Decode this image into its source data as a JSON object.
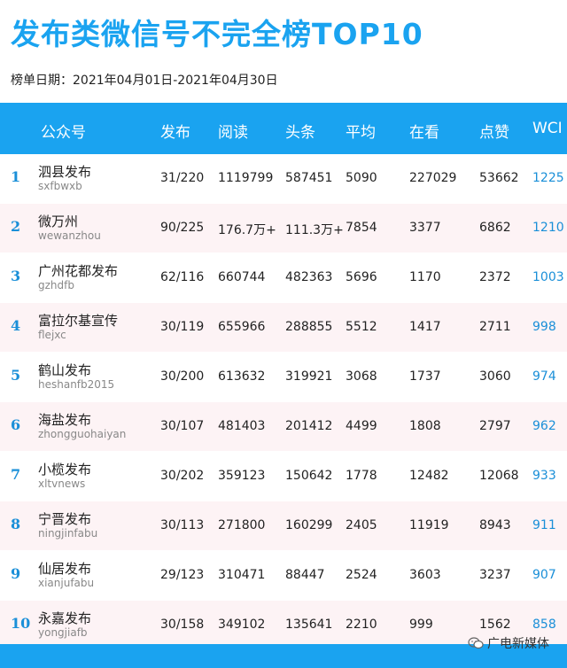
{
  "title": "发布类微信号不完全榜TOP10",
  "date_line": "榜单日期：2021年04月01日-2021年04月30日",
  "headers": {
    "account": "公众号",
    "fabu": "发布",
    "yuedu": "阅读",
    "toutiao": "头条",
    "pingjun": "平均",
    "zaikan": "在看",
    "dianzan": "点赞",
    "wci": "WCI"
  },
  "rows": [
    {
      "rank": "1",
      "name": "泗县发布",
      "account": "sxfbwxb",
      "fabu": "31/220",
      "yuedu": "1119799",
      "toutiao": "587451",
      "pingjun": "5090",
      "zaikan": "227029",
      "dianzan": "53662",
      "wci": "1225"
    },
    {
      "rank": "2",
      "name": "微万州",
      "account": "wewanzhou",
      "fabu": "90/225",
      "yuedu": "176.7万+",
      "toutiao": "111.3万+",
      "pingjun": "7854",
      "zaikan": "3377",
      "dianzan": "6862",
      "wci": "1210"
    },
    {
      "rank": "3",
      "name": "广州花都发布",
      "account": "gzhdfb",
      "fabu": "62/116",
      "yuedu": "660744",
      "toutiao": "482363",
      "pingjun": "5696",
      "zaikan": "1170",
      "dianzan": "2372",
      "wci": "1003"
    },
    {
      "rank": "4",
      "name": "富拉尔基宣传",
      "account": "flejxc",
      "fabu": "30/119",
      "yuedu": "655966",
      "toutiao": "288855",
      "pingjun": "5512",
      "zaikan": "1417",
      "dianzan": "2711",
      "wci": "998"
    },
    {
      "rank": "5",
      "name": "鹤山发布",
      "account": "heshanfb2015",
      "fabu": "30/200",
      "yuedu": "613632",
      "toutiao": "319921",
      "pingjun": "3068",
      "zaikan": "1737",
      "dianzan": "3060",
      "wci": "974"
    },
    {
      "rank": "6",
      "name": "海盐发布",
      "account": "zhongguohaiyan",
      "fabu": "30/107",
      "yuedu": "481403",
      "toutiao": "201412",
      "pingjun": "4499",
      "zaikan": "1808",
      "dianzan": "2797",
      "wci": "962"
    },
    {
      "rank": "7",
      "name": "小榄发布",
      "account": "xltvnews",
      "fabu": "30/202",
      "yuedu": "359123",
      "toutiao": "150642",
      "pingjun": "1778",
      "zaikan": "12482",
      "dianzan": "12068",
      "wci": "933"
    },
    {
      "rank": "8",
      "name": "宁晋发布",
      "account": "ningjinfabu",
      "fabu": "30/113",
      "yuedu": "271800",
      "toutiao": "160299",
      "pingjun": "2405",
      "zaikan": "11919",
      "dianzan": "8943",
      "wci": "911"
    },
    {
      "rank": "9",
      "name": "仙居发布",
      "account": "xianjufabu",
      "fabu": "29/123",
      "yuedu": "310471",
      "toutiao": "88447",
      "pingjun": "2524",
      "zaikan": "3603",
      "dianzan": "3237",
      "wci": "907"
    },
    {
      "rank": "10",
      "name": "永嘉发布",
      "account": "yongjiafb",
      "fabu": "30/158",
      "yuedu": "349102",
      "toutiao": "135641",
      "pingjun": "2210",
      "zaikan": "999",
      "dianzan": "1562",
      "wci": "858"
    }
  ],
  "watermark": "广电新媒体",
  "colors": {
    "accent": "#1aa3f0",
    "rank": "#1a8fd8",
    "alt_row": "#fdf3f5"
  }
}
